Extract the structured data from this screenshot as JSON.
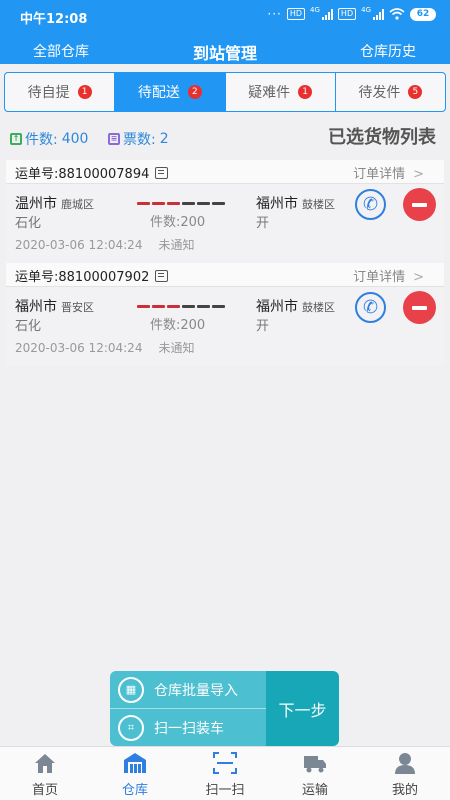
{
  "status_bar": {
    "time": "中午12:08",
    "hd1": "HD",
    "net1": "4G",
    "hd2": "HD",
    "net2": "4G",
    "battery": "62"
  },
  "header": {
    "left": "全部仓库",
    "title": "到站管理",
    "right": "仓库历史"
  },
  "tabs": [
    {
      "label": "待自提",
      "badge": "1"
    },
    {
      "label": "待配送",
      "badge": "2",
      "active": true
    },
    {
      "label": "疑难件",
      "badge": "1"
    },
    {
      "label": "待发件",
      "badge": "5"
    }
  ],
  "summary": {
    "pieces_label": "件数:",
    "pieces_value": "400",
    "tickets_label": "票数:",
    "tickets_value": "2",
    "list_title": "已选货物列表"
  },
  "orders": [
    {
      "waybill": "运单号:88100007894",
      "detail_label": "订单详情",
      "from_city": "温州市",
      "from_district": "鹿城区",
      "from_sub": "石化",
      "to_city": "福州市",
      "to_district": "鼓楼区",
      "to_sub": "开",
      "pieces": "件数:200",
      "time": "2020-03-06 12:04:24",
      "notice": "未通知"
    },
    {
      "waybill": "运单号:88100007902",
      "detail_label": "订单详情",
      "from_city": "福州市",
      "from_district": "晋安区",
      "from_sub": "石化",
      "to_city": "福州市",
      "to_district": "鼓楼区",
      "to_sub": "开",
      "pieces": "件数:200",
      "time": "2020-03-06 12:04:24",
      "notice": "未通知"
    }
  ],
  "actions": {
    "import": "仓库批量导入",
    "scan": "扫一扫装车",
    "next": "下一步"
  },
  "bottom_nav": [
    {
      "label": "首页",
      "icon": "home-icon"
    },
    {
      "label": "仓库",
      "icon": "warehouse-icon",
      "active": true
    },
    {
      "label": "扫一扫",
      "icon": "scan-icon"
    },
    {
      "label": "运输",
      "icon": "truck-icon"
    },
    {
      "label": "我的",
      "icon": "user-icon"
    }
  ],
  "colors": {
    "primary": "#2196f3",
    "badge": "#e8312f",
    "remove": "#e9414a",
    "panel": "#4cbfd1",
    "panel_dark": "#17a7b7"
  }
}
